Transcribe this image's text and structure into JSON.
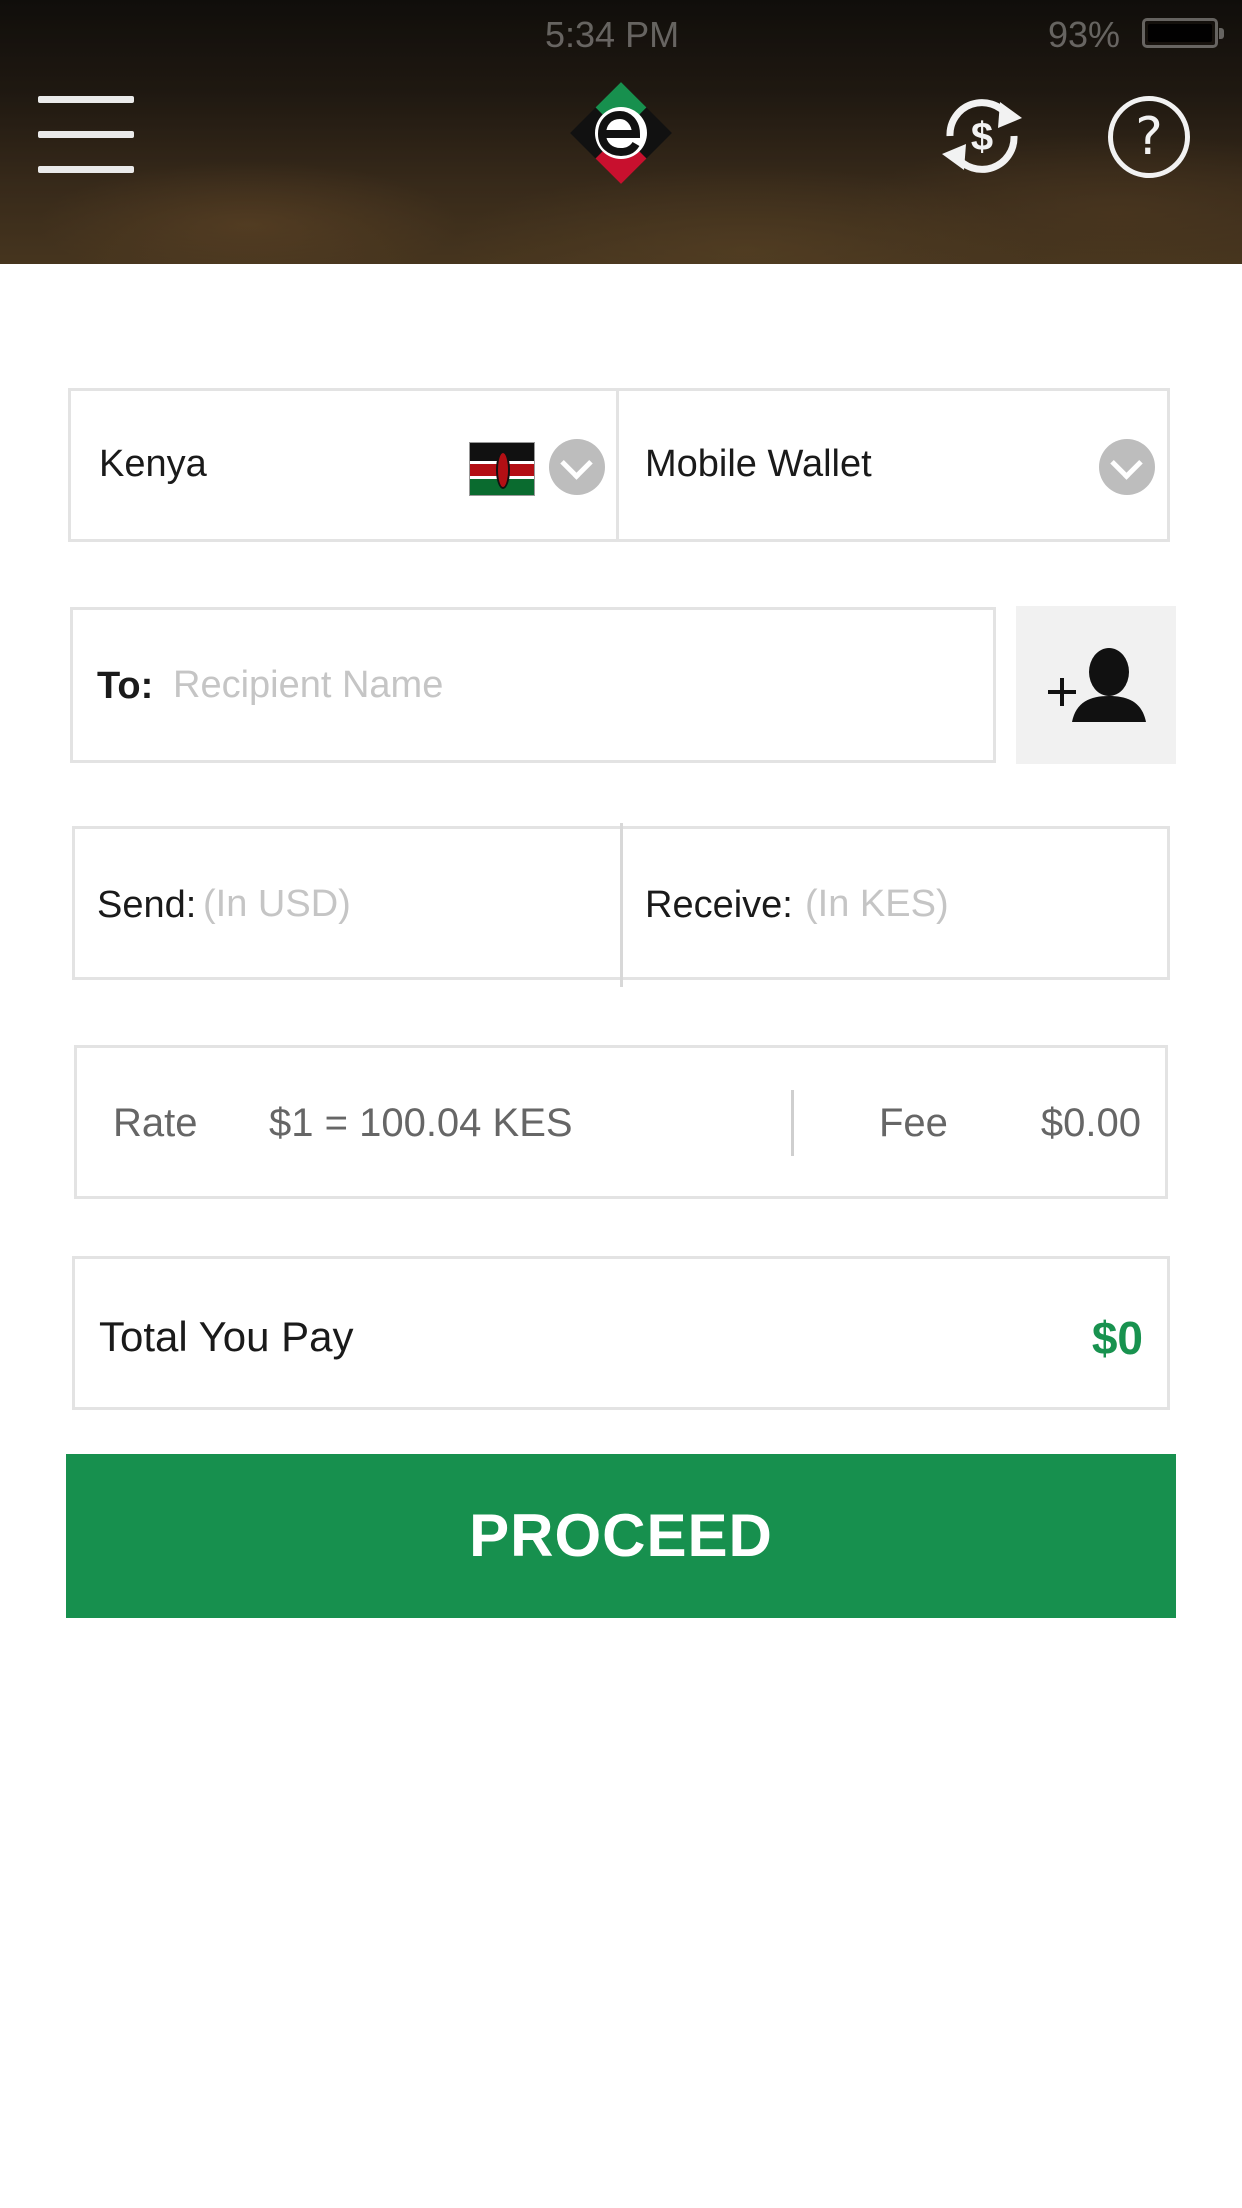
{
  "status_bar": {
    "time": "5:34 PM",
    "battery": "93%"
  },
  "header": {
    "menu_icon": "hamburger-menu-icon",
    "logo": "app-logo",
    "exchange_icon": "currency-exchange-icon",
    "help_icon": "help-icon",
    "help_glyph": "?"
  },
  "destination": {
    "country": "Kenya",
    "country_flag": "kenya-flag-icon",
    "method": "Mobile Wallet"
  },
  "recipient": {
    "label": "To:",
    "placeholder": "Recipient Name",
    "value": "",
    "add_contact_icon": "add-contact-icon"
  },
  "amounts": {
    "send_label": "Send:",
    "send_placeholder": "(In USD)",
    "receive_label": "Receive:",
    "receive_placeholder": "(In KES)"
  },
  "rate": {
    "rate_label": "Rate",
    "rate_value": "$1 = 100.04 KES",
    "fee_label": "Fee",
    "fee_value": "$0.00"
  },
  "total": {
    "label": "Total You Pay",
    "value": "$0"
  },
  "actions": {
    "proceed_label": "PROCEED"
  },
  "colors": {
    "accent_green": "#17904e",
    "total_green": "#18924f",
    "border": "#e3e3e3",
    "placeholder": "#c5c5c5"
  }
}
